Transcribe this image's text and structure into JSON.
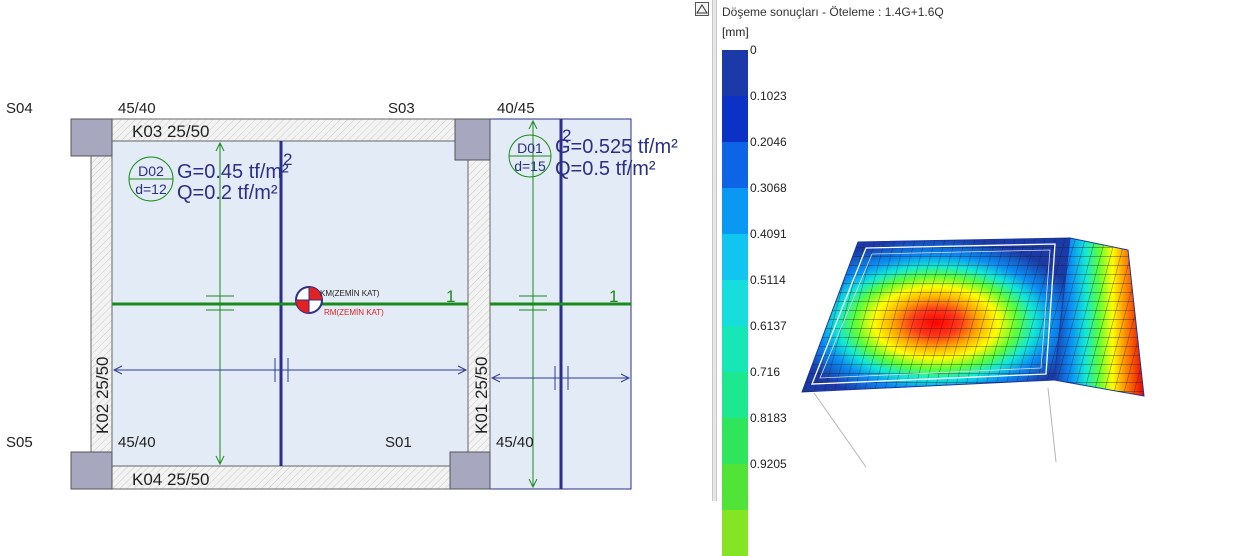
{
  "plan": {
    "columns": {
      "s04": "S04",
      "s03": "S03",
      "s05": "S05",
      "s01": "S01"
    },
    "column_sizes": {
      "top_left": "45/40",
      "top_right": "40/45",
      "bottom_left": "45/40",
      "bottom_right": "45/40"
    },
    "beams": {
      "k03": "K03 25/50",
      "k04": "K04 25/50",
      "k02": "K02 25/50",
      "k01": "K01 25/50"
    },
    "slab_d02": {
      "id": "D02",
      "thickness": "d=12",
      "dead_load": "G=0.45 tf/m²",
      "live_load": "Q=0.2 tf/m²",
      "direction": "2"
    },
    "slab_d01": {
      "id": "D01",
      "thickness": "d=15",
      "dead_load": "G=0.525 tf/m²",
      "live_load": "Q=0.5 tf/m²",
      "direction": "2"
    },
    "axis_1_left": "1",
    "axis_1_right": "1",
    "center_marker": {
      "km_label": "KM(ZEMİN KAT)",
      "rm_label": "RM(ZEMİN KAT)"
    }
  },
  "results": {
    "title": "Döşeme sonuçları - Öteleme : 1.4G+1.6Q",
    "unit": "[mm]",
    "legend_ticks": [
      "0",
      "0.1023",
      "0.2046",
      "0.3068",
      "0.4091",
      "0.5114",
      "0.6137",
      "0.716",
      "0.8183",
      "0.9205"
    ],
    "legend_colors": [
      "#1b3aa8",
      "#0c31c6",
      "#0e64e6",
      "#0a98f2",
      "#12c4f0",
      "#17dedd",
      "#17e6b6",
      "#1ee88f",
      "#2fe55c",
      "#52e338",
      "#86e522"
    ]
  },
  "colors": {
    "slab_fill": "#e3ecf6",
    "beam_blue": "#2b2f88",
    "axis_green": "#1a8a1a",
    "dim_blue": "#2e3c9c",
    "marker_red": "#e32121"
  }
}
